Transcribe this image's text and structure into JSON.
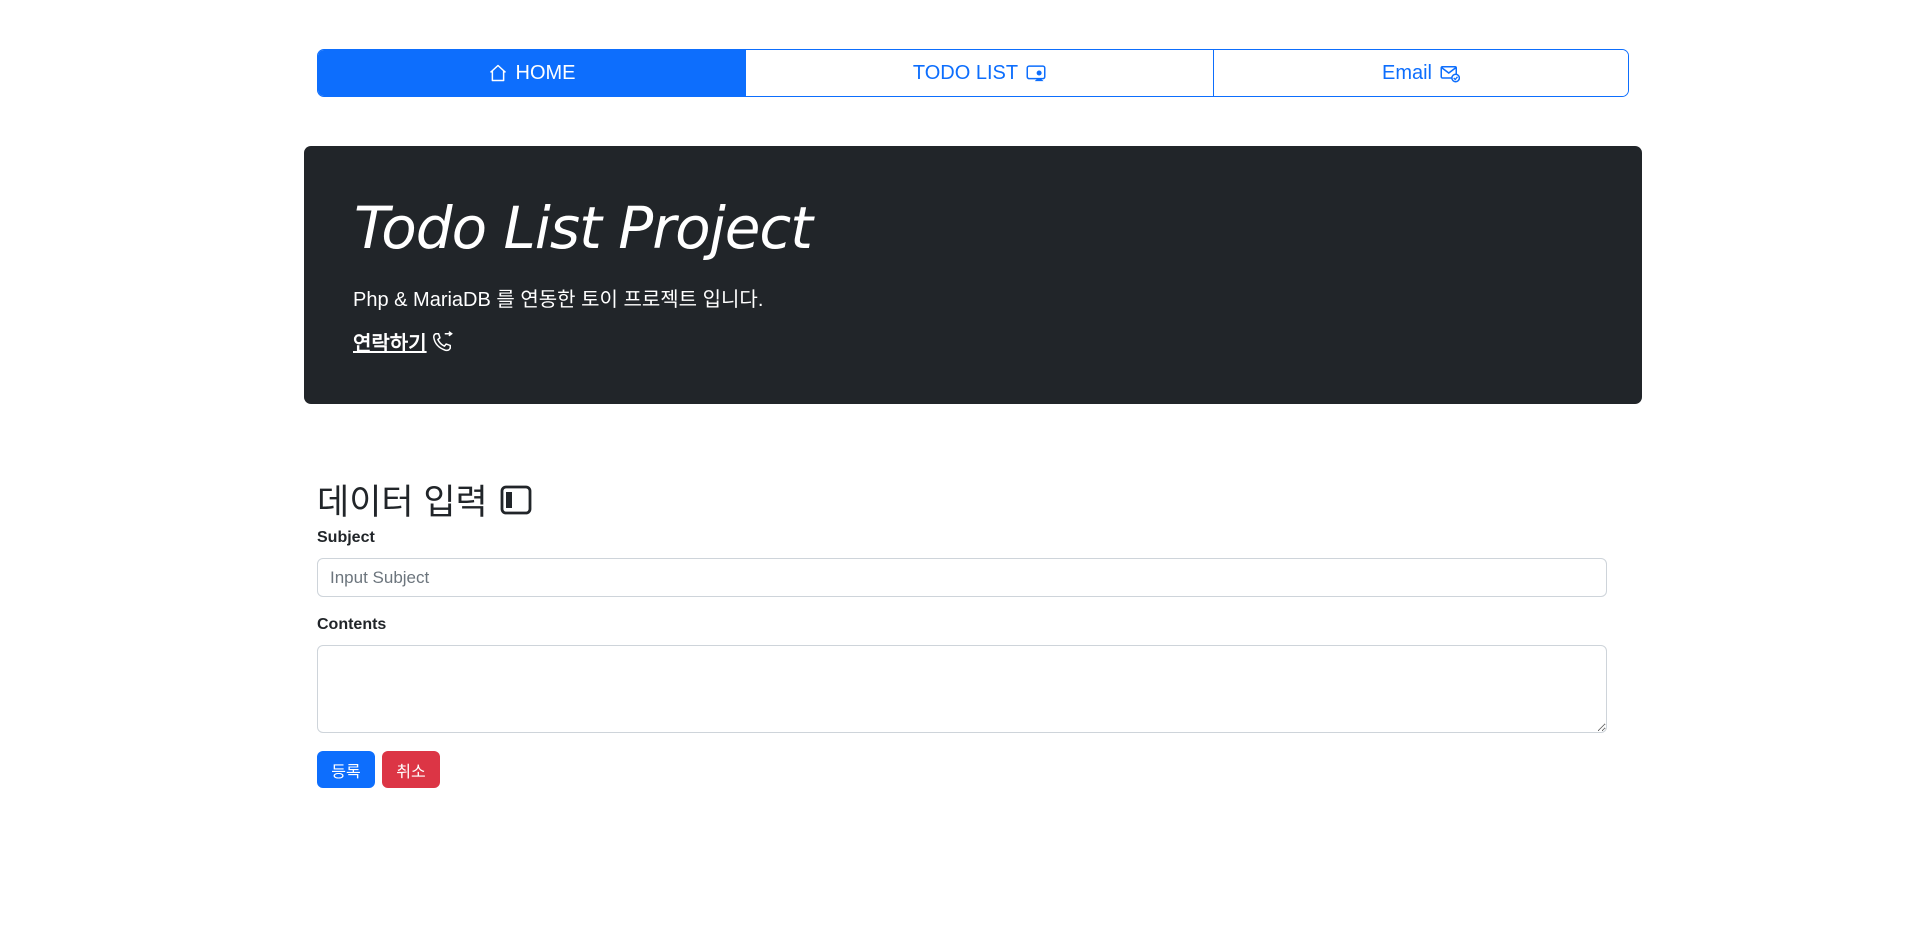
{
  "nav": {
    "home_label": "HOME",
    "todo_label": "TODO LIST",
    "email_label": "Email"
  },
  "hero": {
    "title": "Todo List Project",
    "description": "Php & MariaDB 를 연동한 토이 프로젝트 입니다.",
    "contact_label": "연락하기"
  },
  "form": {
    "title": "데이터 입력",
    "subject_label": "Subject",
    "subject_placeholder": "Input Subject",
    "subject_value": "",
    "contents_label": "Contents",
    "contents_value": "",
    "submit_label": "등록",
    "cancel_label": "취소"
  },
  "colors": {
    "primary": "#0d6efd",
    "danger": "#dc3545",
    "hero_bg": "#212529"
  },
  "icons": {
    "home": "house-icon",
    "todo": "person-video-icon",
    "email": "envelope-check-icon",
    "contact": "telephone-forward-icon",
    "form": "layout-sidebar-icon"
  }
}
